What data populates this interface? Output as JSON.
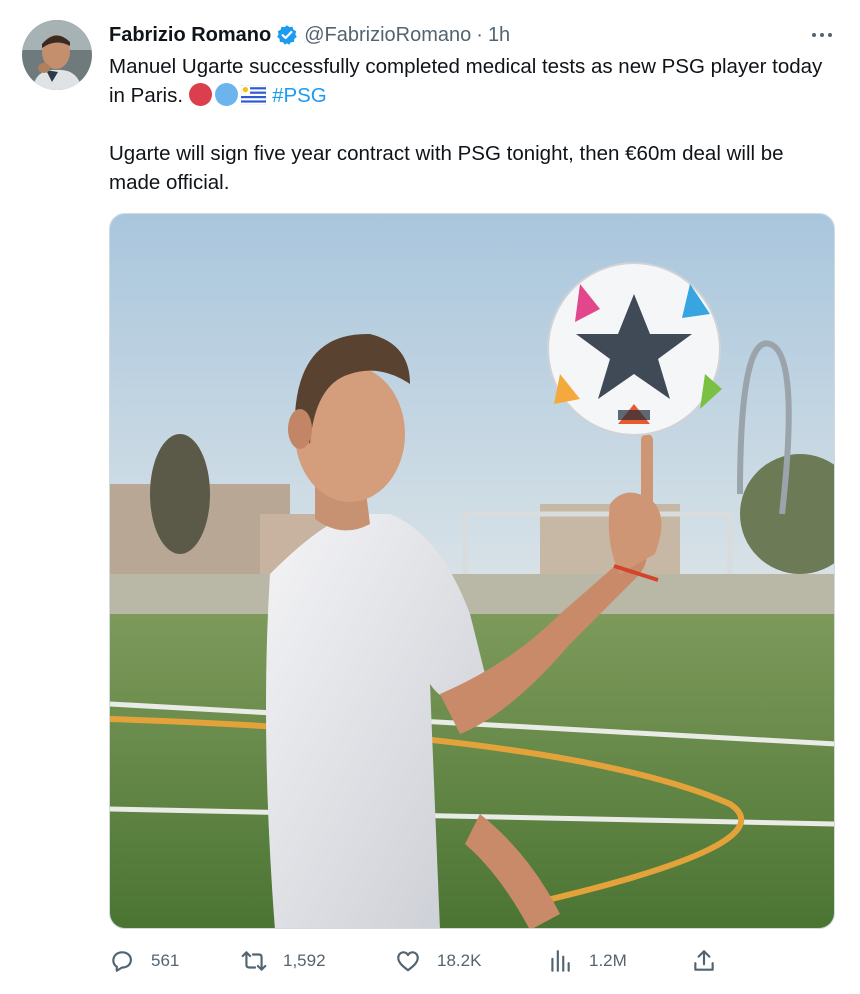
{
  "tweet": {
    "author": {
      "name": "Fabrizio Romano",
      "handle": "@FabrizioRomano",
      "separator": "·",
      "time": "1h",
      "verified": true
    },
    "text": {
      "line1": "Manuel Ugarte successfully completed medical tests as new PSG player today in Paris.",
      "emojis": [
        "red-circle",
        "blue-circle",
        "uruguay-flag"
      ],
      "hashtag": "#PSG",
      "paragraph2": "Ugarte will sign five year contract with PSG tonight, then €60m deal will be made official."
    },
    "media": {
      "type": "photo",
      "icon": "photo"
    },
    "actions": {
      "replies": "561",
      "retweets": "1,592",
      "likes": "18.2K",
      "views": "1.2M"
    },
    "colors": {
      "accent": "#1d9bf0",
      "muted": "#536471",
      "text": "#0f1419"
    }
  }
}
